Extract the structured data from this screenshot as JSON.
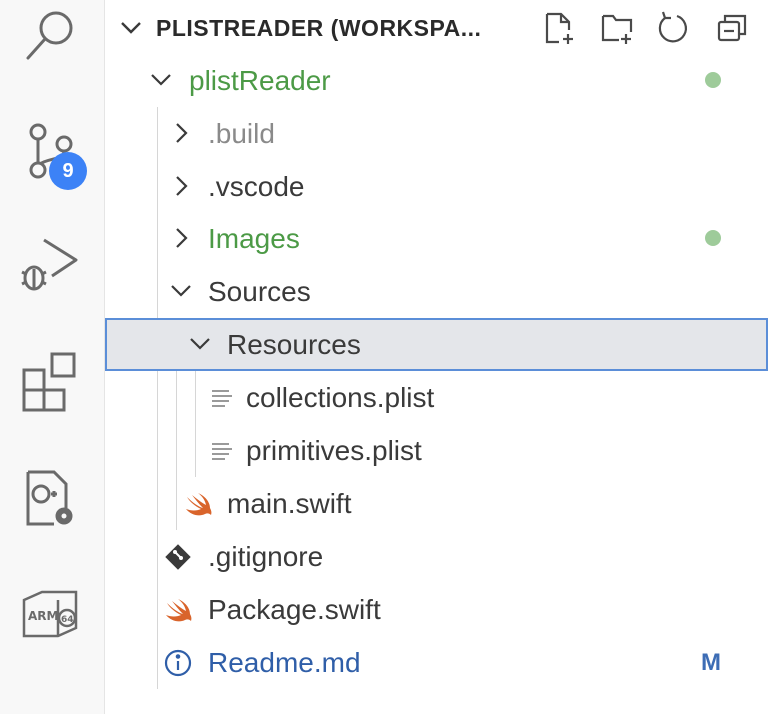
{
  "activity_bar": {
    "items": [
      {
        "icon": "search-icon"
      },
      {
        "icon": "source-control-icon",
        "badge": "9"
      },
      {
        "icon": "run-debug-icon"
      },
      {
        "icon": "extensions-icon"
      },
      {
        "icon": "cpp-config-icon"
      },
      {
        "icon": "arm64-icon"
      }
    ]
  },
  "explorer": {
    "title": "PLISTREADER (WORKSPA...",
    "actions": [
      "new-file-icon",
      "new-folder-icon",
      "refresh-icon",
      "collapse-all-icon"
    ],
    "tree": [
      {
        "label": "plistReader",
        "type": "folder",
        "expanded": true,
        "status": "dot"
      },
      {
        "label": ".build",
        "type": "folder",
        "expanded": false
      },
      {
        "label": ".vscode",
        "type": "folder",
        "expanded": false
      },
      {
        "label": "Images",
        "type": "folder",
        "expanded": false,
        "status": "dot"
      },
      {
        "label": "Sources",
        "type": "folder",
        "expanded": true
      },
      {
        "label": "Resources",
        "type": "folder",
        "expanded": true,
        "selected": true
      },
      {
        "label": "collections.plist",
        "type": "file",
        "icon": "lines-icon"
      },
      {
        "label": "primitives.plist",
        "type": "file",
        "icon": "lines-icon"
      },
      {
        "label": "main.swift",
        "type": "file",
        "icon": "swift-icon"
      },
      {
        "label": ".gitignore",
        "type": "file",
        "icon": "git-icon"
      },
      {
        "label": "Package.swift",
        "type": "file",
        "icon": "swift-icon"
      },
      {
        "label": "Readme.md",
        "type": "file",
        "icon": "info-icon",
        "status": "M"
      }
    ]
  },
  "colors": {
    "git_added": "#4c9a46",
    "git_modified": "#2f5ea8",
    "badge": "#3c82f6",
    "selection": "#e4e6ea",
    "focus_border": "#5b8ed8"
  }
}
